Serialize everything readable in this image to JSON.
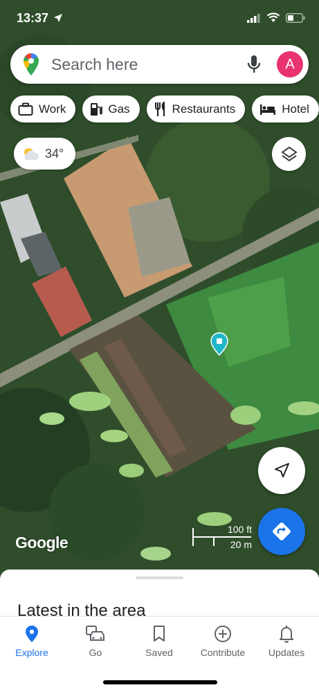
{
  "status_bar": {
    "time": "13:37"
  },
  "search": {
    "placeholder": "Search here",
    "avatar_letter": "A"
  },
  "chips": [
    {
      "label": "Work",
      "icon": "briefcase-icon"
    },
    {
      "label": "Gas",
      "icon": "gas-pump-icon"
    },
    {
      "label": "Restaurants",
      "icon": "fork-knife-icon"
    },
    {
      "label": "Hotel",
      "icon": "bed-icon"
    }
  ],
  "weather": {
    "temperature": "34°",
    "icon": "partly-cloudy-icon"
  },
  "map": {
    "attribution": "Google",
    "scale_imperial": "100 ft",
    "scale_metric": "20 m"
  },
  "sheet": {
    "title": "Latest in the area"
  },
  "nav": [
    {
      "label": "Explore",
      "icon": "explore-pin-icon",
      "active": true
    },
    {
      "label": "Go",
      "icon": "car-icon",
      "active": false
    },
    {
      "label": "Saved",
      "icon": "bookmark-icon",
      "active": false
    },
    {
      "label": "Contribute",
      "icon": "plus-circle-icon",
      "active": false
    },
    {
      "label": "Updates",
      "icon": "bell-icon",
      "active": false
    }
  ],
  "colors": {
    "accent": "#1a73e8",
    "avatar": "#e8336e",
    "pin": "#1fb6c8"
  }
}
